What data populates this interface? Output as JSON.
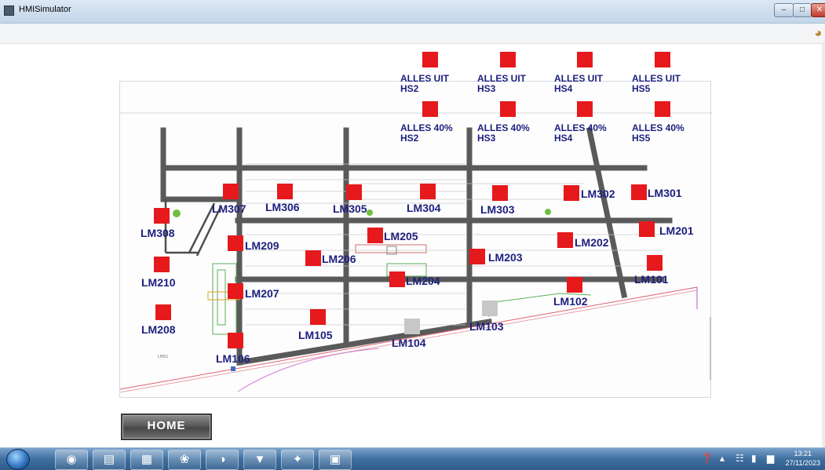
{
  "window": {
    "title": "HMISimulator"
  },
  "home_button": {
    "label": "HOME"
  },
  "hs_controls": [
    {
      "line1": "ALLES UIT",
      "line2": "HS2"
    },
    {
      "line1": "ALLES UIT",
      "line2": "HS3"
    },
    {
      "line1": "ALLES UIT",
      "line2": "HS4"
    },
    {
      "line1": "ALLES UIT",
      "line2": "HS5"
    },
    {
      "line1": "ALLES 40%",
      "line2": "HS2"
    },
    {
      "line1": "ALLES 40%",
      "line2": "HS3"
    },
    {
      "line1": "ALLES 40%",
      "line2": "HS4"
    },
    {
      "line1": "ALLES 40%",
      "line2": "HS5"
    }
  ],
  "lamps": [
    {
      "label": "LM301",
      "status": "red"
    },
    {
      "label": "LM302",
      "status": "red"
    },
    {
      "label": "LM303",
      "status": "red"
    },
    {
      "label": "LM304",
      "status": "red"
    },
    {
      "label": "LM305",
      "status": "red"
    },
    {
      "label": "LM306",
      "status": "red"
    },
    {
      "label": "LM307",
      "status": "red"
    },
    {
      "label": "LM308",
      "status": "red"
    },
    {
      "label": "LM201",
      "status": "red"
    },
    {
      "label": "LM202",
      "status": "red"
    },
    {
      "label": "LM203",
      "status": "red"
    },
    {
      "label": "LM204",
      "status": "red"
    },
    {
      "label": "LM205",
      "status": "red"
    },
    {
      "label": "LM206",
      "status": "red"
    },
    {
      "label": "LM207",
      "status": "red"
    },
    {
      "label": "LM208",
      "status": "red"
    },
    {
      "label": "LM209",
      "status": "red"
    },
    {
      "label": "LM210",
      "status": "red"
    },
    {
      "label": "LM101",
      "status": "red"
    },
    {
      "label": "LM102",
      "status": "red"
    },
    {
      "label": "LM103",
      "status": "grey"
    },
    {
      "label": "LM104",
      "status": "grey"
    },
    {
      "label": "LM105",
      "status": "red"
    },
    {
      "label": "LM106",
      "status": "red"
    }
  ],
  "colors": {
    "on": "#e6191c",
    "off": "#c7c7c7",
    "label": "#1c1f7e",
    "road": "#5a5a5a"
  },
  "taskbar": {
    "apps": [
      "chrome-icon",
      "file-explorer-icon",
      "spreadsheet-icon",
      "paint-icon",
      "edge-icon",
      "tool-red-icon",
      "tool-icon",
      "hmi-icon"
    ],
    "time": "13:21",
    "date": "27/11/2023"
  }
}
